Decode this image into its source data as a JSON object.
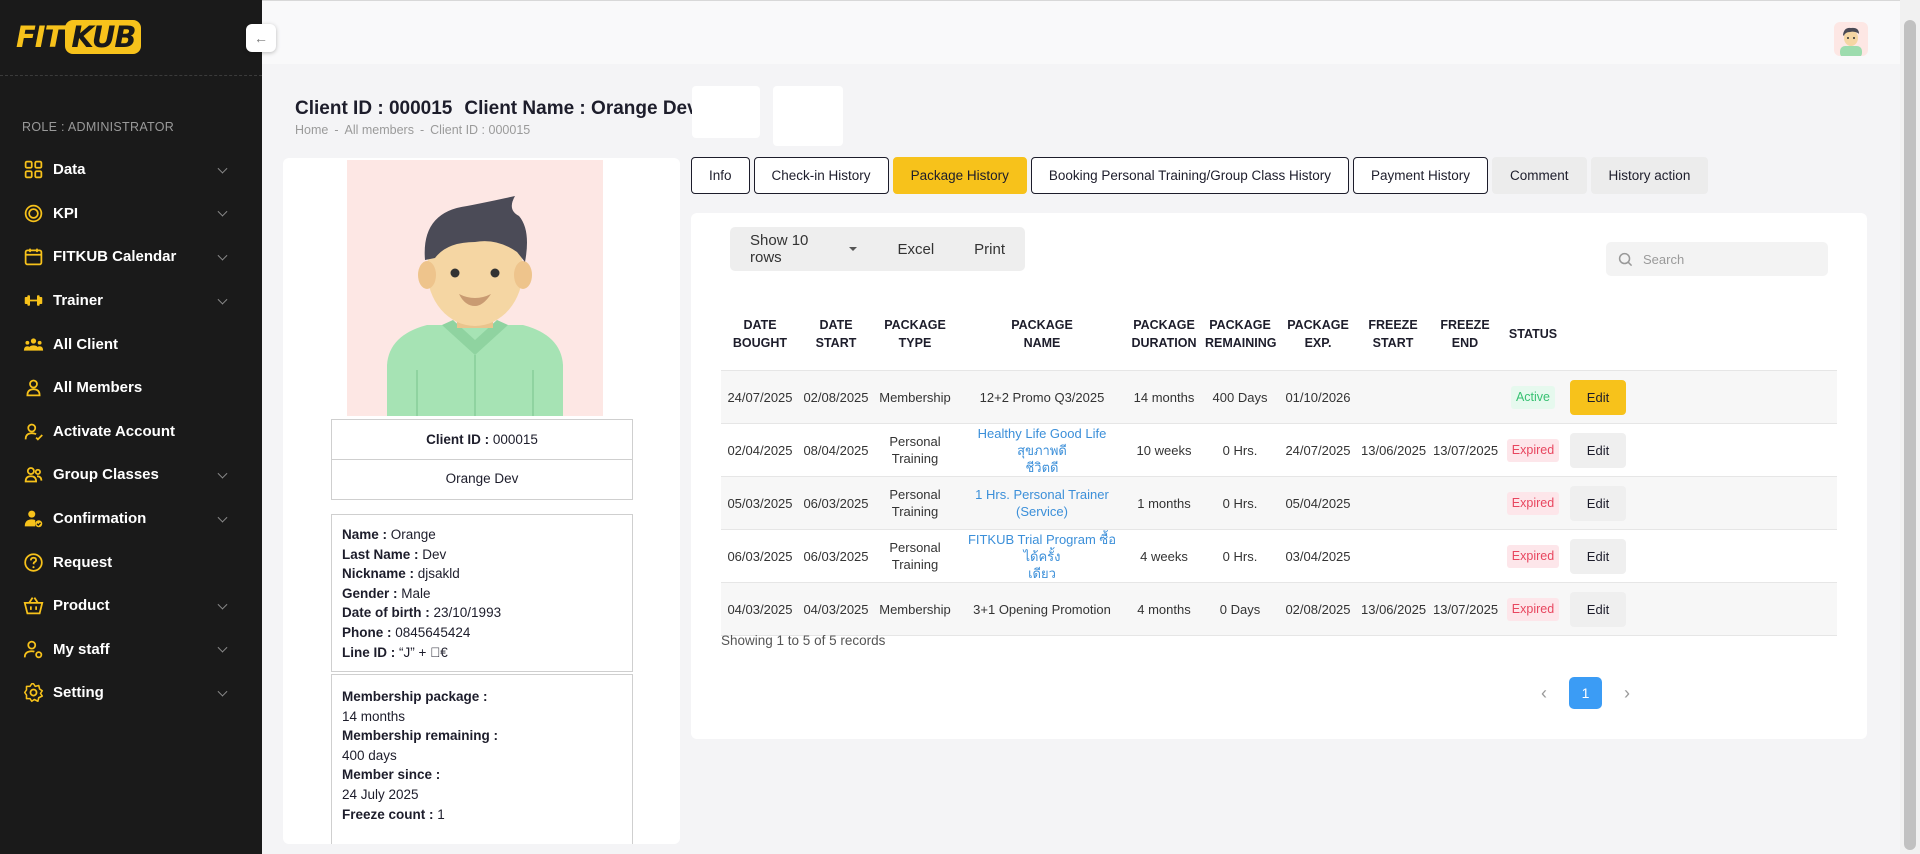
{
  "brand": {
    "logo_left": "FIT",
    "logo_right": "KUB",
    "accent": "#f7c21b",
    "sidebar_bg": "#1a1a1a"
  },
  "sidebar": {
    "role": "ROLE : ADMINISTRATOR",
    "collapse_icon": "arrow-left-icon",
    "items": [
      {
        "label": "Data",
        "icon": "grid-icon",
        "has_children": true
      },
      {
        "label": "KPI",
        "icon": "target-icon",
        "has_children": true
      },
      {
        "label": "FITKUB Calendar",
        "icon": "calendar-icon",
        "has_children": true
      },
      {
        "label": "Trainer",
        "icon": "dumbbell-icon",
        "has_children": true
      },
      {
        "label": "All Client",
        "icon": "users-group-icon",
        "has_children": false
      },
      {
        "label": "All Members",
        "icon": "user-icon",
        "has_children": false
      },
      {
        "label": "Activate Account",
        "icon": "user-check-icon",
        "has_children": false
      },
      {
        "label": "Group Classes",
        "icon": "users-icon",
        "has_children": true
      },
      {
        "label": "Confirmation",
        "icon": "user-confirm-icon",
        "has_children": true
      },
      {
        "label": "Request",
        "icon": "question-circle-icon",
        "has_children": false
      },
      {
        "label": "Product",
        "icon": "basket-icon",
        "has_children": true
      },
      {
        "label": "My staff",
        "icon": "user-gear-icon",
        "has_children": true
      },
      {
        "label": "Setting",
        "icon": "gear-icon",
        "has_children": true
      }
    ]
  },
  "header": {
    "client_id_label": "Client ID : 000015",
    "client_name_label": "Client Name : Orange Dev",
    "breadcrumb": [
      "Home",
      "-",
      "All members",
      "-",
      "Client ID : 000015"
    ]
  },
  "profile": {
    "client_id_key": "Client ID :",
    "client_id_value": "000015",
    "display_name": "Orange Dev",
    "details": [
      {
        "key": "Name :",
        "value": "Orange"
      },
      {
        "key": "Last Name :",
        "value": "Dev"
      },
      {
        "key": "Nickname :",
        "value": "djsakld"
      },
      {
        "key": "Gender :",
        "value": "Male"
      },
      {
        "key": "Date of birth :",
        "value": "23/10/1993"
      },
      {
        "key": "Phone :",
        "value": "0845645424"
      },
      {
        "key": "Line ID :",
        "value": "“J” + \u0000€"
      }
    ],
    "membership": {
      "package_key": "Membership package :",
      "package_value": "14 months",
      "remaining_key": "Membership remaining :",
      "remaining_value": "400 days",
      "since_key": "Member since :",
      "since_value": "24 July 2025",
      "freeze_key": "Freeze count :",
      "freeze_value": "1"
    }
  },
  "tabs": [
    {
      "label": "Info",
      "style": "outline"
    },
    {
      "label": "Check-in History",
      "style": "outline"
    },
    {
      "label": "Package History",
      "style": "active"
    },
    {
      "label": "Booking Personal Training/Group Class History",
      "style": "outline"
    },
    {
      "label": "Payment History",
      "style": "outline"
    },
    {
      "label": "Comment",
      "style": "plain"
    },
    {
      "label": "History action",
      "style": "plain"
    }
  ],
  "toolbar": {
    "rows_label": "Show 10 rows",
    "excel_label": "Excel",
    "print_label": "Print"
  },
  "search": {
    "placeholder": "Search",
    "value": ""
  },
  "table": {
    "headers": [
      [
        "DATE",
        "BOUGHT"
      ],
      [
        "DATE",
        "START"
      ],
      [
        "PACKAGE",
        "TYPE"
      ],
      [
        "PACKAGE",
        "NAME"
      ],
      [
        "PACKAGE",
        "DURATION"
      ],
      [
        "PACKAGE",
        "REMAINING"
      ],
      [
        "PACKAGE",
        "EXP."
      ],
      [
        "FREEZE",
        "START"
      ],
      [
        "FREEZE",
        "END"
      ],
      [
        "STATUS",
        ""
      ],
      [
        "",
        ""
      ]
    ],
    "rows": [
      {
        "date_bought": "24/07/2025",
        "date_start": "02/08/2025",
        "type": [
          "Membership"
        ],
        "name": [
          "12+2 Promo Q3/2025"
        ],
        "name_link": false,
        "duration": "14 months",
        "remaining": "400 Days",
        "exp": "01/10/2026",
        "freeze_start": "",
        "freeze_end": "",
        "status": "Active",
        "edit": "Edit"
      },
      {
        "date_bought": "02/04/2025",
        "date_start": "08/04/2025",
        "type": [
          "Personal",
          "Training"
        ],
        "name": [
          "Healthy Life Good Life สุขภาพดี",
          "ชีวิตดี"
        ],
        "name_link": true,
        "duration": "10 weeks",
        "remaining": "0 Hrs.",
        "exp": "24/07/2025",
        "freeze_start": "13/06/2025",
        "freeze_end": "13/07/2025",
        "status": "Expired",
        "edit": "Edit"
      },
      {
        "date_bought": "05/03/2025",
        "date_start": "06/03/2025",
        "type": [
          "Personal",
          "Training"
        ],
        "name": [
          "1 Hrs. Personal Trainer (Service)"
        ],
        "name_link": true,
        "duration": "1 months",
        "remaining": "0 Hrs.",
        "exp": "05/04/2025",
        "freeze_start": "",
        "freeze_end": "",
        "status": "Expired",
        "edit": "Edit"
      },
      {
        "date_bought": "06/03/2025",
        "date_start": "06/03/2025",
        "type": [
          "Personal",
          "Training"
        ],
        "name": [
          "FITKUB Trial Program ซื้อได้ครั้ง",
          "เดียว"
        ],
        "name_link": true,
        "duration": "4 weeks",
        "remaining": "0 Hrs.",
        "exp": "03/04/2025",
        "freeze_start": "",
        "freeze_end": "",
        "status": "Expired",
        "edit": "Edit"
      },
      {
        "date_bought": "04/03/2025",
        "date_start": "04/03/2025",
        "type": [
          "Membership"
        ],
        "name": [
          "3+1 Opening Promotion"
        ],
        "name_link": false,
        "duration": "4 months",
        "remaining": "0 Days",
        "exp": "02/08/2025",
        "freeze_start": "13/06/2025",
        "freeze_end": "13/07/2025",
        "status": "Expired",
        "edit": "Edit"
      }
    ]
  },
  "footer": {
    "showing": "Showing 1 to 5 of 5 records",
    "page": "1"
  },
  "colors": {
    "active_status": "#38c172",
    "expired_status": "#e8465f",
    "link": "#3b8fd9",
    "pager": "#3b9cf5"
  }
}
